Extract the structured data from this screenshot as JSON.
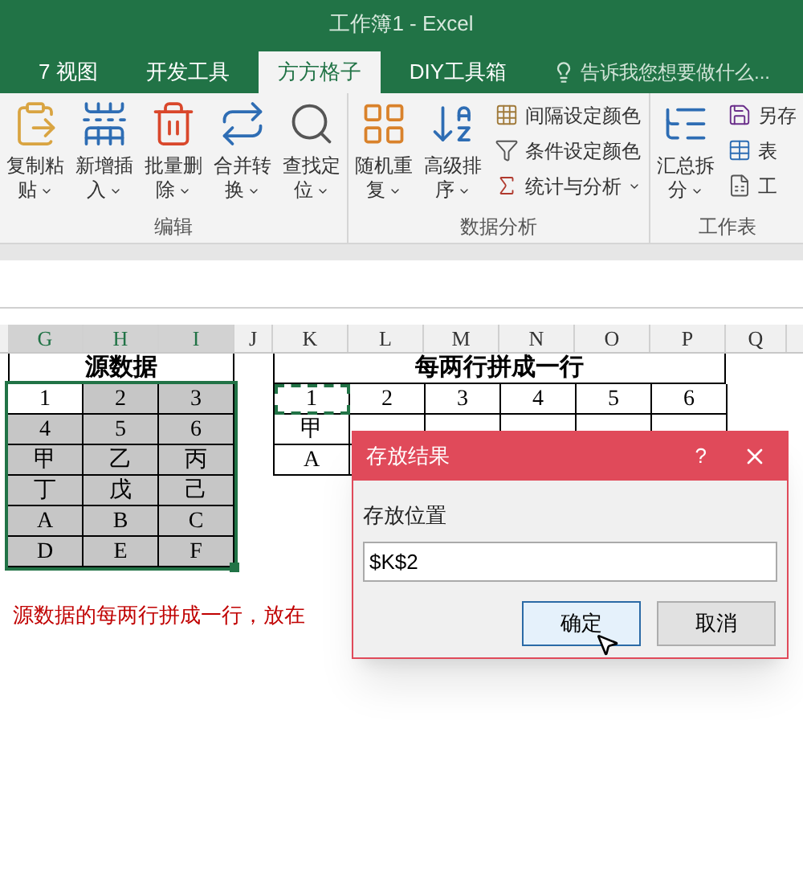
{
  "window": {
    "title": "工作簿1 - Excel"
  },
  "tabs": [
    {
      "label": "7 视图",
      "selected": false
    },
    {
      "label": "开发工具",
      "selected": false
    },
    {
      "label": "方方格子",
      "selected": true
    },
    {
      "label": "DIY工具箱",
      "selected": false
    }
  ],
  "tell_me": {
    "placeholder": "告诉我您想要做什么..."
  },
  "ribbon_groups": [
    {
      "label": "编辑",
      "items": [
        {
          "kind": "large",
          "lines": [
            "复制粘",
            "贴"
          ]
        },
        {
          "kind": "large",
          "lines": [
            "新增插",
            "入"
          ]
        },
        {
          "kind": "large",
          "lines": [
            "批量删",
            "除"
          ]
        },
        {
          "kind": "large",
          "lines": [
            "合并转",
            "换"
          ]
        },
        {
          "kind": "large",
          "lines": [
            "查找定",
            "位"
          ]
        }
      ]
    },
    {
      "label": "数据分析",
      "items": [
        {
          "kind": "large",
          "lines": [
            "随机重",
            "复"
          ]
        },
        {
          "kind": "large",
          "lines": [
            "高级排",
            "序"
          ]
        },
        {
          "kind": "stack",
          "entries": [
            {
              "label": "间隔设定颜色",
              "dropdown": false
            },
            {
              "label": "条件设定颜色",
              "dropdown": false
            },
            {
              "label": "统计与分析",
              "dropdown": true
            }
          ]
        }
      ]
    },
    {
      "label": "工作表",
      "items": [
        {
          "kind": "large",
          "lines": [
            "汇总拆",
            "分"
          ]
        },
        {
          "kind": "stack",
          "entries": [
            {
              "label": "另存",
              "dropdown": false
            },
            {
              "label": "表",
              "dropdown": false
            },
            {
              "label": "工",
              "dropdown": false
            }
          ]
        }
      ]
    }
  ],
  "columns": [
    {
      "label": "G",
      "selected": true
    },
    {
      "label": "H",
      "selected": true
    },
    {
      "label": "I",
      "selected": true
    },
    {
      "label": "J",
      "selected": false
    },
    {
      "label": "K",
      "selected": false
    },
    {
      "label": "L",
      "selected": false
    },
    {
      "label": "M",
      "selected": false
    },
    {
      "label": "N",
      "selected": false
    },
    {
      "label": "O",
      "selected": false
    },
    {
      "label": "P",
      "selected": false
    },
    {
      "label": "Q",
      "selected": false
    }
  ],
  "source": {
    "title": "源数据",
    "selected": true,
    "rows": [
      [
        "1",
        "2",
        "3"
      ],
      [
        "4",
        "5",
        "6"
      ],
      [
        "甲",
        "乙",
        "丙"
      ],
      [
        "丁",
        "戊",
        "己"
      ],
      [
        "A",
        "B",
        "C"
      ],
      [
        "D",
        "E",
        "F"
      ]
    ]
  },
  "result": {
    "title": "每两行拼成一行",
    "copy_marquee": true,
    "rows": [
      [
        "1",
        "2",
        "3",
        "4",
        "5",
        "6"
      ],
      [
        "甲"
      ],
      [
        "A"
      ]
    ]
  },
  "note": "源数据的每两行拼成一行，放在",
  "dialog": {
    "title": "存放结果",
    "help": "?",
    "field_label": "存放位置",
    "value": "$K$2",
    "buttons": [
      {
        "label": "确定",
        "default": true
      },
      {
        "label": "取消",
        "default": false
      }
    ]
  }
}
